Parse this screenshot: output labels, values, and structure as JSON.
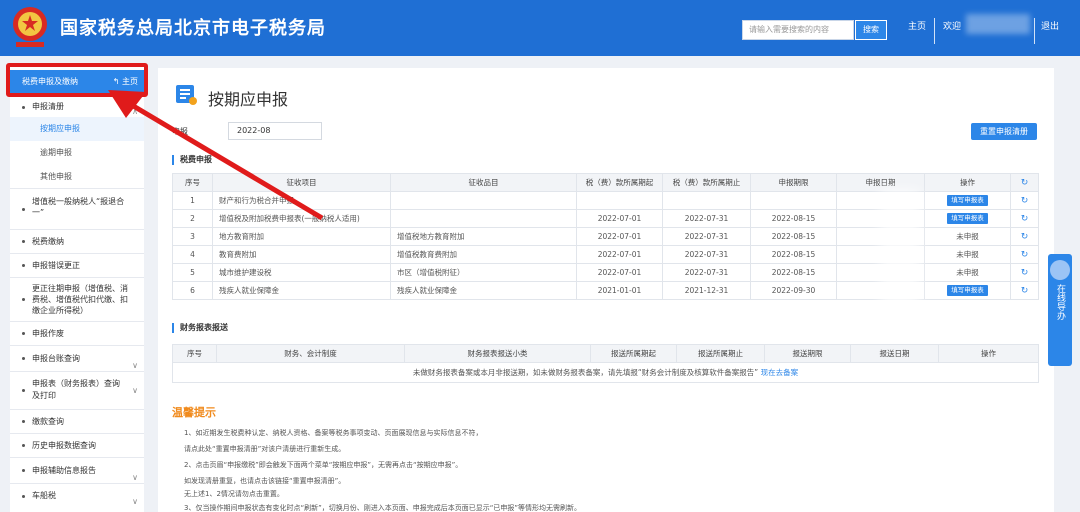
{
  "header": {
    "title": "国家税务总局北京市电子税务局",
    "search_placeholder": "请输入需要搜索的内容",
    "search_button": "搜索",
    "home": "主页",
    "welcome": "欢迎",
    "logout": "退出"
  },
  "sidebar": {
    "head": "税费申报及缴纳",
    "home": "主页",
    "items": [
      {
        "label": "申报清册"
      },
      {
        "label": "按期应申报"
      },
      {
        "label": "逾期申报"
      },
      {
        "label": "其他申报"
      },
      {
        "label": "增值税一般纳税人“报退合一”"
      },
      {
        "label": "税费缴纳"
      },
      {
        "label": "申报错误更正"
      },
      {
        "label": "更正往期申报（增值税、消费税、增值税代扣代缴、扣缴企业所得税）"
      },
      {
        "label": "申报作废"
      },
      {
        "label": "申报台账查询"
      },
      {
        "label": "申报表（财务报表）查询及打印"
      },
      {
        "label": "缴款查询"
      },
      {
        "label": "历史申报数据查询"
      },
      {
        "label": "申报辅助信息报告"
      },
      {
        "label": "车船税"
      }
    ]
  },
  "main": {
    "title": "按期应申报",
    "period_label": "申报",
    "period_value": "2022-08",
    "reset_button": "重置申报清册",
    "tax_section": "税费申报",
    "tax_columns": [
      "序号",
      "征收项目",
      "征收品目",
      "税（费）款所属期起",
      "税（费）款所属期止",
      "申报期限",
      "申报日期",
      "操作"
    ],
    "tax_rows": [
      {
        "no": "1",
        "item": "财产和行为税合并申报",
        "sub": "",
        "start": "",
        "end": "",
        "deadline": "",
        "date": "",
        "op": "填写申报表"
      },
      {
        "no": "2",
        "item": "增值税及附加税费申报表(一般纳税人适用)",
        "sub": "",
        "start": "2022-07-01",
        "end": "2022-07-31",
        "deadline": "2022-08-15",
        "date": "",
        "op": "填写申报表"
      },
      {
        "no": "3",
        "item": "地方教育附加",
        "sub": "增值税地方教育附加",
        "start": "2022-07-01",
        "end": "2022-07-31",
        "deadline": "2022-08-15",
        "date": "",
        "op": "未申报"
      },
      {
        "no": "4",
        "item": "教育费附加",
        "sub": "增值税教育费附加",
        "start": "2022-07-01",
        "end": "2022-07-31",
        "deadline": "2022-08-15",
        "date": "",
        "op": "未申报"
      },
      {
        "no": "5",
        "item": "城市维护建设税",
        "sub": "市区（增值税附征）",
        "start": "2022-07-01",
        "end": "2022-07-31",
        "deadline": "2022-08-15",
        "date": "",
        "op": "未申报"
      },
      {
        "no": "6",
        "item": "残疾人就业保障金",
        "sub": "残疾人就业保障金",
        "start": "2021-01-01",
        "end": "2021-12-31",
        "deadline": "2022-09-30",
        "date": "",
        "op": "填写申报表"
      }
    ],
    "fin_section": "财务报表报送",
    "fin_columns": [
      "序号",
      "财务、会计制度",
      "财务报表报送小类",
      "报送所属期起",
      "报送所属期止",
      "报送期限",
      "报送日期",
      "操作"
    ],
    "fin_empty_text": "未做财务报表备案或本月非报送期，如未做财务报表备案，请先填报“财务会计制度及核算软件备案报告”",
    "fin_empty_link": "现在去备案",
    "tips_title": "温馨提示",
    "tips": [
      "1、如近期发生税费种认定、纳税人资格、备案等税务事项变动、页面展现信息与实际信息不符，",
      "请点此处“重置申报清册”对该户清册进行重新生成。",
      "2、点击页眉“申报缴税”即会触发下面两个菜单“按期应申报”，无需再点击“按期应申报”。",
      "如发现清册重复，也请点击该链接“重置申报清册”。",
      "无上述1、2情况请勿点击重置。",
      "3、仅当操作期间申报状态有变化时点“刷新”，切换月份、刚进入本页面、申报完成后本页面已显示“已申报”等情形均无需刷新。"
    ]
  },
  "float": {
    "label": "在线导办"
  },
  "colors": {
    "header_blue": "#1f6fd4",
    "accent": "#2c86e8",
    "highlight_red": "#e01b1b",
    "tips_orange": "#f08a1c"
  }
}
